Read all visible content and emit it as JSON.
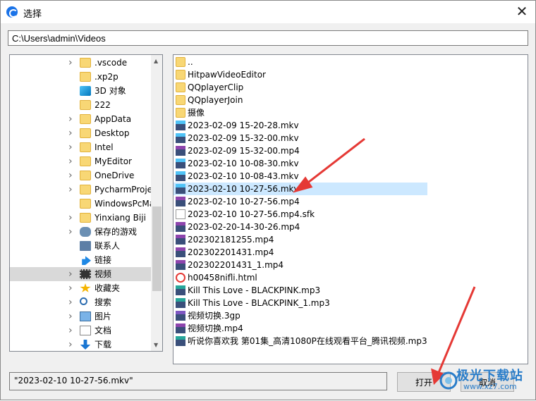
{
  "window": {
    "title": "选择",
    "close_glyph": "✕"
  },
  "path_bar": {
    "value": "C:\\Users\\admin\\Videos"
  },
  "tree": {
    "items": [
      {
        "label": ".vscode",
        "icon": "folder-icon",
        "has_children": true,
        "selected": false
      },
      {
        "label": ".xp2p",
        "icon": "folder-icon",
        "has_children": false,
        "selected": false
      },
      {
        "label": "3D 对象",
        "icon": "3d-objects-icon",
        "has_children": false,
        "selected": false
      },
      {
        "label": "222",
        "icon": "folder-icon",
        "has_children": false,
        "selected": false
      },
      {
        "label": "AppData",
        "icon": "folder-icon",
        "has_children": true,
        "selected": false
      },
      {
        "label": "Desktop",
        "icon": "folder-icon",
        "has_children": true,
        "selected": false
      },
      {
        "label": "Intel",
        "icon": "folder-icon",
        "has_children": true,
        "selected": false
      },
      {
        "label": "MyEditor",
        "icon": "folder-icon",
        "has_children": true,
        "selected": false
      },
      {
        "label": "OneDrive",
        "icon": "folder-icon",
        "has_children": true,
        "selected": false
      },
      {
        "label": "PycharmProje",
        "icon": "folder-icon",
        "has_children": true,
        "selected": false
      },
      {
        "label": "WindowsPcMa",
        "icon": "folder-icon",
        "has_children": false,
        "selected": false
      },
      {
        "label": "Yinxiang Biji",
        "icon": "folder-icon",
        "has_children": true,
        "selected": false
      },
      {
        "label": "保存的游戏",
        "icon": "gamepad-icon",
        "has_children": true,
        "selected": false
      },
      {
        "label": "联系人",
        "icon": "contacts-icon",
        "has_children": false,
        "selected": false
      },
      {
        "label": "链接",
        "icon": "link-icon",
        "has_children": false,
        "selected": false
      },
      {
        "label": "视频",
        "icon": "video-icon",
        "has_children": true,
        "selected": true
      },
      {
        "label": "收藏夹",
        "icon": "star-icon",
        "has_children": true,
        "selected": false
      },
      {
        "label": "搜索",
        "icon": "search-icon",
        "has_children": true,
        "selected": false
      },
      {
        "label": "图片",
        "icon": "picture-icon",
        "has_children": true,
        "selected": false
      },
      {
        "label": "文档",
        "icon": "document-icon",
        "has_children": true,
        "selected": false
      },
      {
        "label": "下载",
        "icon": "download-icon",
        "has_children": true,
        "selected": false
      }
    ]
  },
  "files": {
    "items": [
      {
        "label": "..",
        "type": "folder"
      },
      {
        "label": "HitpawVideoEditor",
        "type": "folder"
      },
      {
        "label": "QQplayerClip",
        "type": "folder"
      },
      {
        "label": "QQplayerJoin",
        "type": "folder"
      },
      {
        "label": "摄像",
        "type": "folder"
      },
      {
        "label": "2023-02-09 15-20-28.mkv",
        "type": "mkv"
      },
      {
        "label": "2023-02-09 15-32-00.mkv",
        "type": "mkv"
      },
      {
        "label": "2023-02-09 15-32-00.mp4",
        "type": "mp4"
      },
      {
        "label": "2023-02-10 10-08-30.mkv",
        "type": "mkv"
      },
      {
        "label": "2023-02-10 10-08-43.mkv",
        "type": "mkv"
      },
      {
        "label": "2023-02-10 10-27-56.mkv",
        "type": "mkv",
        "selected": true
      },
      {
        "label": "2023-02-10 10-27-56.mp4",
        "type": "mp4"
      },
      {
        "label": "2023-02-10 10-27-56.mp4.sfk",
        "type": "blank"
      },
      {
        "label": "2023-02-20-14-30-26.mp4",
        "type": "mp4"
      },
      {
        "label": "202302181255.mp4",
        "type": "mp4"
      },
      {
        "label": "202302201431.mp4",
        "type": "mp4"
      },
      {
        "label": "202302201431_1.mp4",
        "type": "mp4"
      },
      {
        "label": "h00458nifli.html",
        "type": "html"
      },
      {
        "label": "Kill This Love - BLACKPINK.mp3",
        "type": "mp3"
      },
      {
        "label": "Kill This Love - BLACKPINK_1.mp3",
        "type": "mp3"
      },
      {
        "label": "视频切换.3gp",
        "type": "3gp"
      },
      {
        "label": "视频切换.mp4",
        "type": "mp4"
      },
      {
        "label": "听说你喜欢我 第01集_高清1080P在线观看平台_腾讯视频.mp3",
        "type": "mp3"
      }
    ]
  },
  "filename_field": {
    "value": "\"2023-02-10 10-27-56.mkv\""
  },
  "buttons": {
    "open_label": "打开",
    "cancel_label": "取消"
  },
  "watermark": {
    "text": "极光下载站",
    "sub": "www.xz7.com"
  },
  "colors": {
    "selection": "#cce8ff",
    "annotation_arrow": "#e53935",
    "watermark": "#2a7dc9"
  }
}
